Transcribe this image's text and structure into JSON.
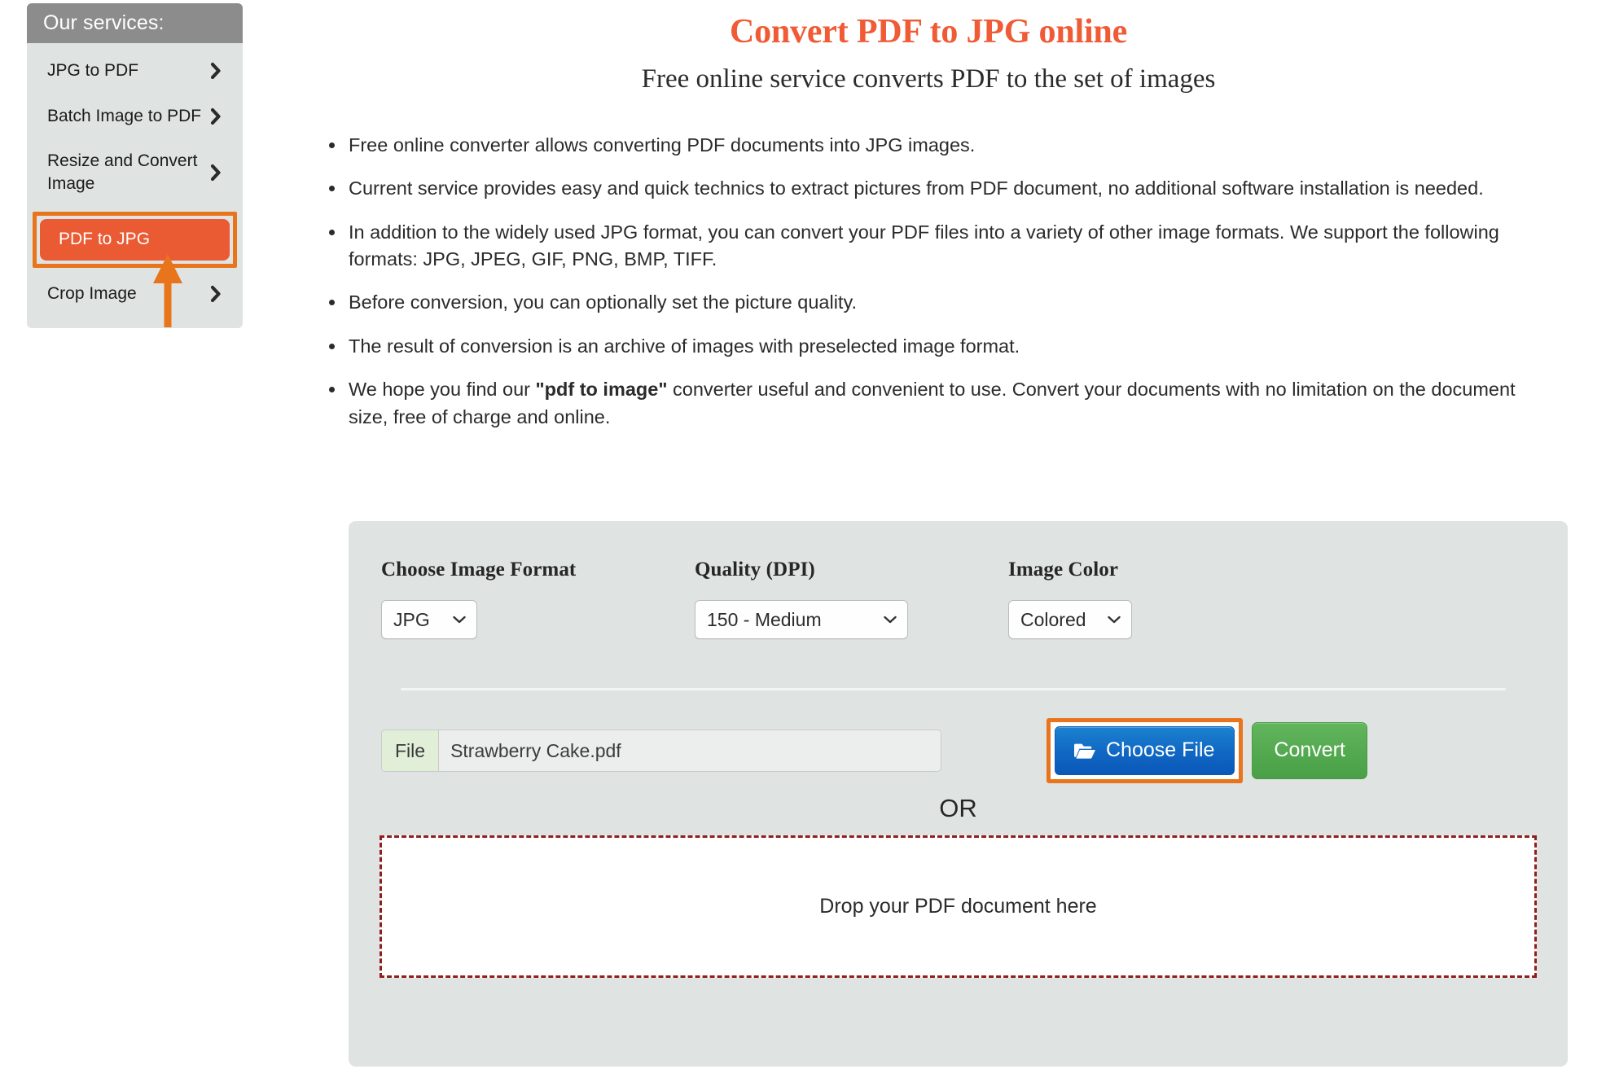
{
  "sidebar": {
    "header": "Our services:",
    "items": [
      {
        "label": "JPG to PDF",
        "icon": "chevron-right-icon",
        "active": false
      },
      {
        "label": "Batch Image to PDF",
        "icon": "chevron-right-icon",
        "active": false
      },
      {
        "label": "Resize and Convert Image",
        "icon": "chevron-right-icon",
        "active": false
      },
      {
        "label": "PDF to JPG",
        "icon": "",
        "active": true
      },
      {
        "label": "Crop Image",
        "icon": "chevron-right-icon",
        "active": false
      }
    ]
  },
  "header": {
    "title": "Convert PDF to JPG online",
    "subtitle": "Free online service converts PDF to the set of images"
  },
  "features": [
    "Free online converter allows converting PDF documents into JPG images.",
    "Current service provides easy and quick technics to extract pictures from PDF document, no additional software installation is needed.",
    "In addition to the widely used JPG format, you can convert your PDF files into a variety of other image formats. We support the following formats: JPG, JPEG, GIF, PNG, BMP, TIFF.",
    "Before conversion, you can optionally set the picture quality.",
    "The result of conversion is an archive of images with preselected image format."
  ],
  "feature_last": {
    "part1": "We hope you find our ",
    "emphasis": "\"pdf to image\"",
    "part2": " converter useful and convenient to use. Convert your documents with no limitation on the document size, free of charge and online."
  },
  "form": {
    "format": {
      "label": "Choose Image Format",
      "value": "JPG"
    },
    "quality": {
      "label": "Quality (DPI)",
      "value": "150 - Medium"
    },
    "color": {
      "label": "Image Color",
      "value": "Colored"
    },
    "file": {
      "prefix": "File",
      "value": "Strawberry Cake.pdf"
    },
    "choose_file_button": "Choose File",
    "convert_button": "Convert",
    "or_label": "OR",
    "dropzone_label": "Drop your PDF document here"
  },
  "colors": {
    "accent_orange": "#ea5a33",
    "annotation_orange": "#e8741c",
    "title_orange": "#f05a35",
    "panel_gray": "#dfe3e2",
    "header_gray": "#8c8c8c",
    "blue_button": "#1169c4",
    "green_button": "#52a84f",
    "dropzone_border": "#8f1f1f"
  }
}
